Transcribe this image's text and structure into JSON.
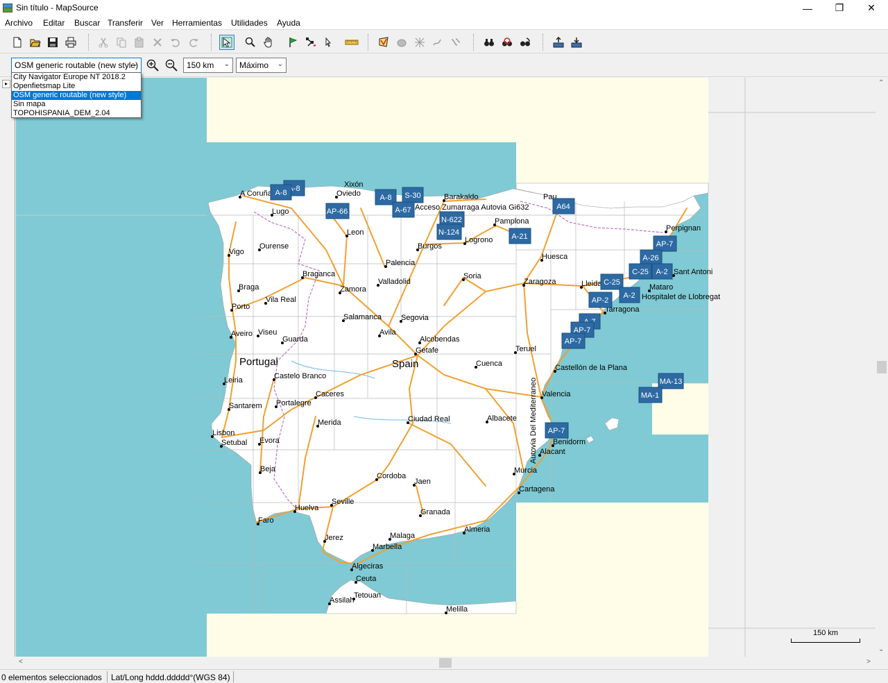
{
  "window": {
    "title": "Sin título - MapSource",
    "minimize": "—",
    "restore": "❐",
    "close": "✕"
  },
  "menu": [
    "Archivo",
    "Editar",
    "Buscar",
    "Transferir",
    "Ver",
    "Herramientas",
    "Utilidades",
    "Ayuda"
  ],
  "toolbar": {
    "icons": [
      "new-file-icon",
      "open-folder-icon",
      "save-icon",
      "print-icon",
      "cut-icon",
      "copy-icon",
      "paste-icon",
      "delete-icon",
      "undo-icon",
      "redo-icon",
      "select-tool-icon",
      "zoom-tool-icon",
      "pan-tool-icon",
      "waypoint-tool-icon",
      "route-tool-icon",
      "track-tool-icon",
      "distance-tool-icon",
      "map-tool-icon",
      "erase-map-icon",
      "selection-tool-icon",
      "track-divide-icon",
      "track-join-icon",
      "find-icon",
      "find-nearby-icon",
      "find-places-icon",
      "send-to-device-icon",
      "receive-from-device-icon"
    ]
  },
  "maptoolbar": {
    "product_value": "OSM generic routable (new style)",
    "zoom_value": "150 km",
    "detail_value": "Máximo"
  },
  "dropdown": {
    "options": [
      "City Navigator Europe NT 2018.2",
      "Openfietsmap Lite",
      "OSM generic routable (new style)",
      "Sin mapa",
      "TOPOHISPANIA_DEM_2.04"
    ],
    "selected_index": 2
  },
  "map": {
    "countries": [
      "Portugal",
      "Spain"
    ],
    "cities": [
      "A Coruña",
      "Xixón",
      "Oviedo",
      "Lugo",
      "Barakaldo",
      "Acceso Zumarraga Autovia Gi632",
      "Pau",
      "Leon",
      "Pamplona",
      "Logrono",
      "Perpignan",
      "Vigo",
      "Ourense",
      "Burgos",
      "Huesca",
      "Palencia",
      "Braganca",
      "Soria",
      "Sant Antoni",
      "Braga",
      "Valladolid",
      "Zaragoza",
      "Lleida",
      "Mataro",
      "Vila Real",
      "Zamora",
      "Hospitalet de Llobregat",
      "Porto",
      "Salamanca",
      "Segovia",
      "Tarragona",
      "Aveiro",
      "Viseu",
      "Avila",
      "Alcobendas",
      "Guarda",
      "Getafe",
      "Teruel",
      "Cuenca",
      "Leiria",
      "Castelo Branco",
      "Castellón de la Plana",
      "Caceres",
      "Santarem",
      "Portalegre",
      "Valencia",
      "Merida",
      "Ciudad Real",
      "Albacete",
      "Lisbon",
      "Setubal",
      "Evora",
      "Benidorm",
      "Alacant",
      "Beja",
      "Cordoba",
      "Jaen",
      "Murcia",
      "Cartagena",
      "Seville",
      "Huelva",
      "Granada",
      "Faro",
      "Almeria",
      "Jerez",
      "Malaga",
      "Marbella",
      "Algeciras",
      "Ceuta",
      "Tetouan",
      "Assilah",
      "Melilla"
    ],
    "road_label_vertical": "Autovia Del Mediterraneo",
    "road_signs": [
      "A-8",
      "A-8",
      "A-8",
      "S-30",
      "AP-66",
      "A-67",
      "N-622",
      "N-124",
      "A64",
      "A-21",
      "AP-7",
      "A-26",
      "C-25",
      "A-2",
      "C-25",
      "A-2",
      "AP-2",
      "A-7",
      "AP-7",
      "AP-7",
      "MA-13",
      "MA-1",
      "AP-7"
    ],
    "colors": {
      "sea": "#7fcad4",
      "land": "#ffffff",
      "outside": "#fffde8",
      "road": "#f0a030",
      "border": "#c070c0"
    }
  },
  "scale_label": "150 km",
  "status": {
    "selection": "0 elementos seleccionados",
    "coord_format": "Lat/Long hddd.ddddd°(WGS 84)"
  }
}
